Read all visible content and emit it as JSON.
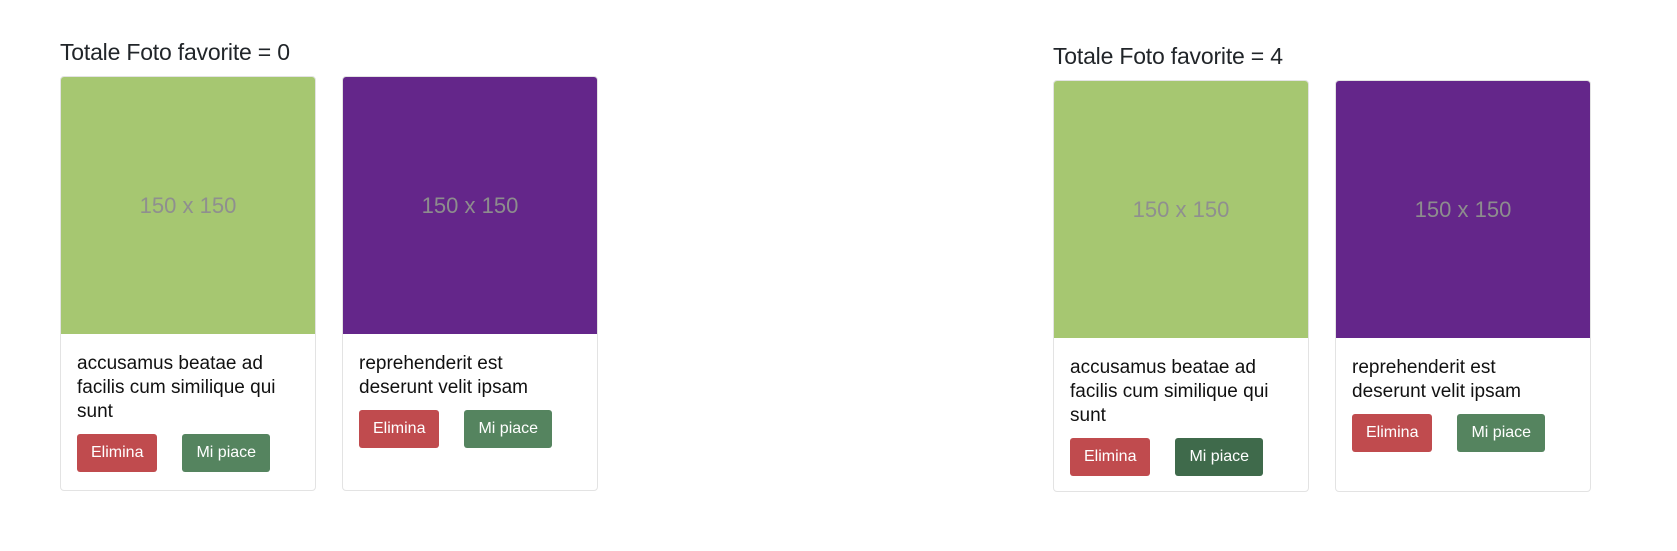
{
  "panels": [
    {
      "title": "Totale Foto favorite = 0",
      "cards": [
        {
          "image_label": "150 x 150",
          "image_color": "#a6c771",
          "title": "accusamus beatae ad facilis cum similique qui sunt",
          "delete_label": "Elimina",
          "like_label": "Mi piace"
        },
        {
          "image_label": "150 x 150",
          "image_color": "#64268a",
          "title": "reprehenderit est deserunt velit ipsam",
          "delete_label": "Elimina",
          "like_label": "Mi piace"
        }
      ]
    },
    {
      "title": "Totale Foto favorite = 4",
      "cards": [
        {
          "image_label": "150 x 150",
          "image_color": "#a6c771",
          "title": "accusamus beatae ad facilis cum similique qui sunt",
          "delete_label": "Elimina",
          "like_label": "Mi piace"
        },
        {
          "image_label": "150 x 150",
          "image_color": "#64268a",
          "title": "reprehenderit est deserunt velit ipsam",
          "delete_label": "Elimina",
          "like_label": "Mi piace"
        }
      ]
    }
  ],
  "colors": {
    "danger": "#c04b4e",
    "success": "#55845f",
    "success_active": "#3f6a4b"
  }
}
